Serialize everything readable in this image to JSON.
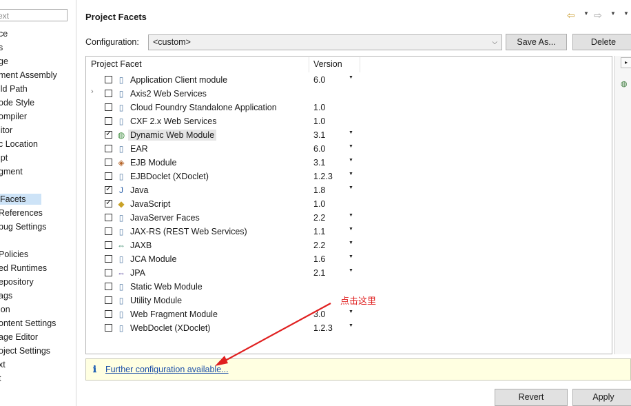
{
  "nav": {
    "filter_placeholder": "ext",
    "items": [
      {
        "label": "ce",
        "selected": false
      },
      {
        "label": "s",
        "selected": false
      },
      {
        "label": "ge",
        "selected": false
      },
      {
        "label": "ment Assembly",
        "selected": false
      },
      {
        "label": "ild Path",
        "selected": false
      },
      {
        "label": "ode Style",
        "selected": false
      },
      {
        "label": "ompiler",
        "selected": false
      },
      {
        "label": "litor",
        "selected": false
      },
      {
        "label": "c Location",
        "selected": false
      },
      {
        "label": "ipt",
        "selected": false
      },
      {
        "label": "gment",
        "selected": false
      },
      {
        "label": "",
        "selected": false
      },
      {
        "label": "Facets",
        "selected": true
      },
      {
        "label": "References",
        "selected": false
      },
      {
        "label": "bug Settings",
        "selected": false
      },
      {
        "label": "",
        "selected": false
      },
      {
        "label": "Policies",
        "selected": false
      },
      {
        "label": "ed Runtimes",
        "selected": false
      },
      {
        "label": "epository",
        "selected": false
      },
      {
        "label": "ags",
        "selected": false
      },
      {
        "label": "ion",
        "selected": false
      },
      {
        "label": "ontent Settings",
        "selected": false
      },
      {
        "label": "age Editor",
        "selected": false
      },
      {
        "label": "oject Settings",
        "selected": false
      },
      {
        "label": "xt",
        "selected": false
      },
      {
        "label": "t",
        "selected": false
      }
    ]
  },
  "header": {
    "title": "Project Facets",
    "icons": [
      "back-arrow-icon",
      "forward-arrow-icon",
      "view-menu-icon"
    ]
  },
  "configuration": {
    "label": "Configuration:",
    "value": "<custom>",
    "save_as_label": "Save As...",
    "delete_label": "Delete"
  },
  "facets_table": {
    "col_facet": "Project Facet",
    "col_version": "Version",
    "rows": [
      {
        "name": "Application Client module",
        "version": "6.0",
        "checked": false,
        "has_dropdown": true,
        "expandable": false,
        "icon": "document-icon"
      },
      {
        "name": "Axis2 Web Services",
        "version": "",
        "checked": false,
        "has_dropdown": false,
        "expandable": true,
        "icon": "document-icon"
      },
      {
        "name": "Cloud Foundry Standalone Application",
        "version": "1.0",
        "checked": false,
        "has_dropdown": false,
        "expandable": false,
        "icon": "document-icon"
      },
      {
        "name": "CXF 2.x Web Services",
        "version": "1.0",
        "checked": false,
        "has_dropdown": false,
        "expandable": false,
        "icon": "document-icon"
      },
      {
        "name": "Dynamic Web Module",
        "version": "3.1",
        "checked": true,
        "has_dropdown": true,
        "expandable": false,
        "icon": "globe-icon",
        "highlighted": true
      },
      {
        "name": "EAR",
        "version": "6.0",
        "checked": false,
        "has_dropdown": true,
        "expandable": false,
        "icon": "document-icon"
      },
      {
        "name": "EJB Module",
        "version": "3.1",
        "checked": false,
        "has_dropdown": true,
        "expandable": false,
        "icon": "bean-icon"
      },
      {
        "name": "EJBDoclet (XDoclet)",
        "version": "1.2.3",
        "checked": false,
        "has_dropdown": true,
        "expandable": false,
        "icon": "document-icon"
      },
      {
        "name": "Java",
        "version": "1.8",
        "checked": true,
        "has_dropdown": true,
        "expandable": false,
        "icon": "java-icon"
      },
      {
        "name": "JavaScript",
        "version": "1.0",
        "checked": true,
        "has_dropdown": false,
        "expandable": false,
        "icon": "javascript-icon"
      },
      {
        "name": "JavaServer Faces",
        "version": "2.2",
        "checked": false,
        "has_dropdown": true,
        "expandable": false,
        "icon": "document-icon"
      },
      {
        "name": "JAX-RS (REST Web Services)",
        "version": "1.1",
        "checked": false,
        "has_dropdown": true,
        "expandable": false,
        "icon": "document-icon"
      },
      {
        "name": "JAXB",
        "version": "2.2",
        "checked": false,
        "has_dropdown": true,
        "expandable": false,
        "icon": "jaxb-icon"
      },
      {
        "name": "JCA Module",
        "version": "1.6",
        "checked": false,
        "has_dropdown": true,
        "expandable": false,
        "icon": "document-icon"
      },
      {
        "name": "JPA",
        "version": "2.1",
        "checked": false,
        "has_dropdown": true,
        "expandable": false,
        "icon": "jpa-icon"
      },
      {
        "name": "Static Web Module",
        "version": "",
        "checked": false,
        "has_dropdown": false,
        "expandable": false,
        "icon": "document-icon"
      },
      {
        "name": "Utility Module",
        "version": "",
        "checked": false,
        "has_dropdown": false,
        "expandable": false,
        "icon": "document-icon"
      },
      {
        "name": "Web Fragment Module",
        "version": "3.0",
        "checked": false,
        "has_dropdown": true,
        "expandable": false,
        "icon": "document-icon"
      },
      {
        "name": "WebDoclet (XDoclet)",
        "version": "1.2.3",
        "checked": false,
        "has_dropdown": true,
        "expandable": false,
        "icon": "document-icon"
      }
    ]
  },
  "info_bar": {
    "icon": "info-icon",
    "link_text": "Further configuration available..."
  },
  "annotation": {
    "text": "点击这里",
    "color": "#e02020"
  },
  "buttons": {
    "revert_label": "Revert",
    "apply_label": "Apply"
  }
}
